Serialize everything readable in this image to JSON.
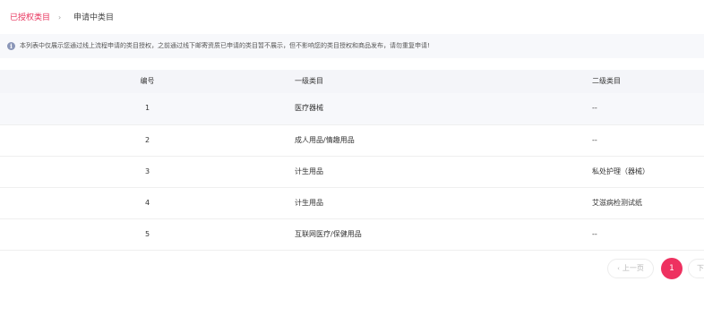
{
  "tabs": {
    "authorized": "已授权类目",
    "applying": "申请中类目"
  },
  "notice": {
    "text": "本列表中仅展示您通过线上流程申请的类目授权，之前通过线下邮寄资质已申请的类目暂不展示，但不影响您的类目授权和商品发布，请勿重复申请!"
  },
  "table": {
    "headers": {
      "no": "编号",
      "level1": "一级类目",
      "level2": "二级类目"
    },
    "rows": [
      {
        "no": "1",
        "level1": "医疗器械",
        "level2": "--"
      },
      {
        "no": "2",
        "level1": "成人用品/情趣用品",
        "level2": "--"
      },
      {
        "no": "3",
        "level1": "计生用品",
        "level2": "私处护理（器械）"
      },
      {
        "no": "4",
        "level1": "计生用品",
        "level2": "艾滋病检测试纸"
      },
      {
        "no": "5",
        "level1": "互联网医疗/保健用品",
        "level2": "--"
      }
    ]
  },
  "pagination": {
    "prev_label": "上一页",
    "current_page": "1",
    "next_label": "下一页"
  }
}
